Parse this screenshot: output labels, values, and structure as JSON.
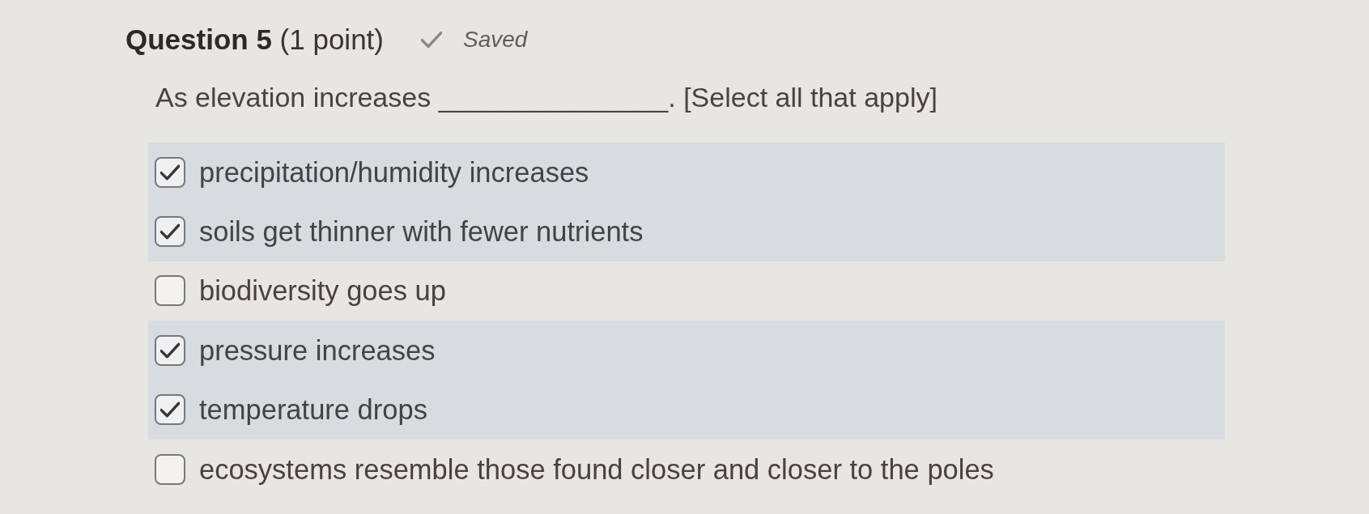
{
  "question": {
    "title": "**Question 5** (1 point)",
    "save_status": "Saved"
  },
  "prompt": "As elevation increases _______________. [Select all that apply]",
  "options": [
    {
      "label": "precipitation/humidity increases",
      "checked": true
    },
    {
      "label": "soils get thinner with fewer nutrients",
      "checked": true
    },
    {
      "label": "biodiversity goes up",
      "checked": false
    },
    {
      "label": "pressure increases",
      "checked": true
    },
    {
      "label": "temperature drops",
      "checked": true
    },
    {
      "label": "ecosystems resemble those found closer and closer to the poles",
      "checked": false
    }
  ]
}
